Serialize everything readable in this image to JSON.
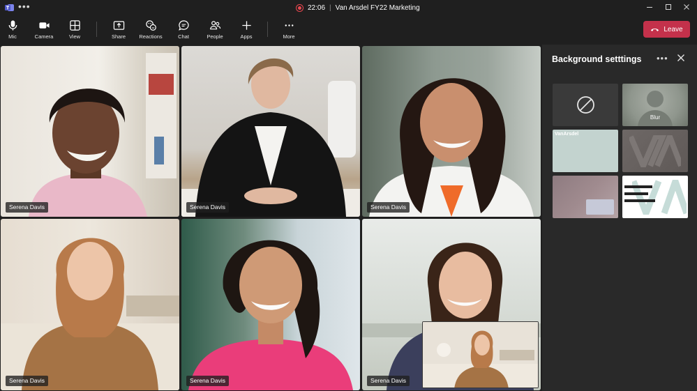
{
  "titlebar": {
    "time": "22:06",
    "separator": "|",
    "meeting_title": "Van Arsdel FY22 Marketing",
    "more": "•••",
    "recording_color": "#e9474f"
  },
  "toolbar": {
    "items": [
      {
        "label": "Mic",
        "icon": "mic-icon"
      },
      {
        "label": "Camera",
        "icon": "camera-icon"
      },
      {
        "label": "View",
        "icon": "view-grid-icon"
      },
      {
        "label": "Share",
        "icon": "share-icon"
      },
      {
        "label": "Reactions",
        "icon": "reactions-icon"
      },
      {
        "label": "Chat",
        "icon": "chat-icon"
      },
      {
        "label": "People",
        "icon": "people-icon"
      },
      {
        "label": "Apps",
        "icon": "plus-icon"
      },
      {
        "label": "More",
        "icon": "more-icon"
      }
    ],
    "leave_label": "Leave",
    "leave_color": "#c4314b"
  },
  "participants": [
    {
      "name": "Serena Davis"
    },
    {
      "name": "Serena Davis"
    },
    {
      "name": "Serena Davis"
    },
    {
      "name": "Serena Davis"
    },
    {
      "name": "Serena Davis"
    },
    {
      "name": "Serena Davis"
    }
  ],
  "panel": {
    "title": "Background setttings",
    "more": "•••",
    "options": [
      {
        "kind": "none",
        "icon": "no-background-icon"
      },
      {
        "kind": "blur",
        "caption": "Blur"
      },
      {
        "kind": "image",
        "text": "VanArsdel"
      },
      {
        "kind": "image",
        "text": ""
      },
      {
        "kind": "image",
        "text": ""
      },
      {
        "kind": "image",
        "text": ""
      }
    ]
  }
}
